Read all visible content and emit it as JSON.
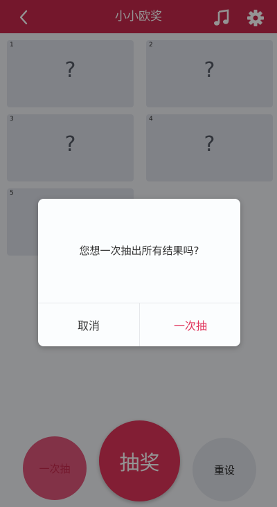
{
  "header": {
    "title": "小小欧奖",
    "back_icon": "chevron-left-icon",
    "music_icon": "music-note-icon",
    "settings_icon": "gear-icon",
    "bg_color": "#c8294d"
  },
  "cards": [
    {
      "number": "1",
      "symbol": "?"
    },
    {
      "number": "2",
      "symbol": "?"
    },
    {
      "number": "3",
      "symbol": "?"
    },
    {
      "number": "4",
      "symbol": "?"
    },
    {
      "number": "5",
      "symbol": "?"
    }
  ],
  "buttons": {
    "draw_all": "一次抽",
    "draw": "抽奖",
    "reset": "重设"
  },
  "dialog": {
    "message": "您想一次抽出所有结果吗?",
    "cancel": "取消",
    "confirm": "一次抽",
    "confirm_color": "#e0325a"
  }
}
